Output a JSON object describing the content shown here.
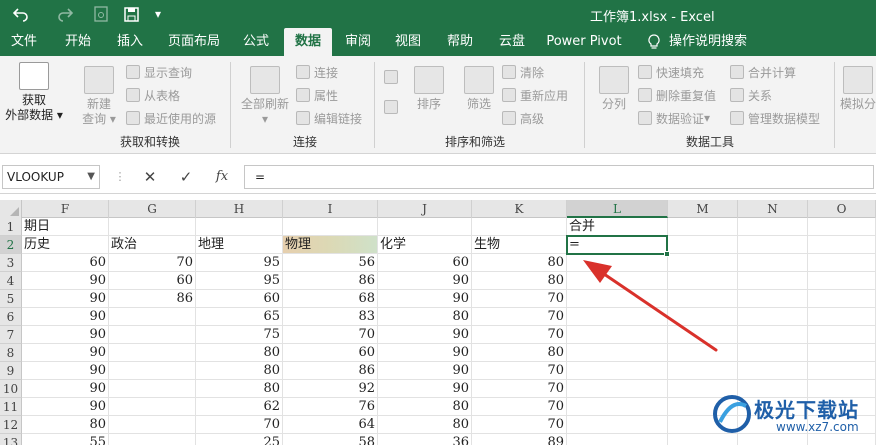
{
  "window": {
    "title": "工作簿1.xlsx  -  Excel"
  },
  "quick_access": {
    "undo_icon": "undo-icon",
    "redo_icon": "redo-icon",
    "save_icon": "save-icon"
  },
  "tabs": [
    "文件",
    "开始",
    "插入",
    "页面布局",
    "公式",
    "数据",
    "审阅",
    "视图",
    "帮助",
    "云盘",
    "Power Pivot",
    "操作说明搜索"
  ],
  "active_tab": "数据",
  "ribbon": {
    "get_data": {
      "label_line1": "获取",
      "label_line2": "外部数据"
    },
    "new_query": {
      "label_line1": "新建",
      "label_line2": "查询"
    },
    "show_query": "显示查询",
    "from_table": "从表格",
    "recent_sources": "最近使用的源",
    "group_get_transform": "获取和转换",
    "refresh_all": "全部刷新",
    "connections": "连接",
    "properties": "属性",
    "edit_links": "编辑链接",
    "group_connections": "连接",
    "sort": "排序",
    "filter": "筛选",
    "clear": "清除",
    "reapply": "重新应用",
    "advanced": "高级",
    "group_sort_filter": "排序和筛选",
    "split": "分列",
    "flash_fill": "快速填充",
    "remove_duplicates": "删除重复值",
    "data_validation": "数据验证",
    "consolidate": "合并计算",
    "relationships": "关系",
    "manage_model": "管理数据模型",
    "group_data_tools": "数据工具",
    "whatif": "模拟分"
  },
  "formula_bar": {
    "name_box": "VLOOKUP",
    "cancel": "✕",
    "enter": "✓",
    "fx": "fx",
    "content": "="
  },
  "columns": [
    "F",
    "G",
    "H",
    "I",
    "J",
    "K",
    "L",
    "M",
    "N",
    "O"
  ],
  "selected_column": "L",
  "rows": [
    "1",
    "2",
    "3",
    "4",
    "5",
    "6",
    "7",
    "8",
    "9",
    "10",
    "11",
    "12",
    "13"
  ],
  "selected_row": "2",
  "sheet": {
    "row1": {
      "F": "期日",
      "L": "合并"
    },
    "headers": [
      "历史",
      "政治",
      "地理",
      "物理",
      "化学",
      "生物"
    ],
    "active_input": "=",
    "data": [
      [
        "60",
        "70",
        "95",
        "56",
        "60",
        "80"
      ],
      [
        "90",
        "60",
        "95",
        "86",
        "90",
        "80"
      ],
      [
        "90",
        "86",
        "60",
        "68",
        "90",
        "70"
      ],
      [
        "90",
        "",
        "65",
        "83",
        "80",
        "70"
      ],
      [
        "90",
        "",
        "75",
        "70",
        "90",
        "70"
      ],
      [
        "90",
        "",
        "80",
        "60",
        "90",
        "80"
      ],
      [
        "90",
        "",
        "80",
        "86",
        "90",
        "70"
      ],
      [
        "90",
        "",
        "80",
        "92",
        "90",
        "70"
      ],
      [
        "90",
        "",
        "62",
        "76",
        "80",
        "70"
      ],
      [
        "80",
        "",
        "70",
        "64",
        "80",
        "70"
      ],
      [
        "55",
        "",
        "25",
        "58",
        "36",
        "89"
      ]
    ]
  },
  "colors": {
    "accent": "#217346",
    "arrow": "#d9312b",
    "watermark": "#1f5fa8"
  },
  "watermark": {
    "title": "极光下载站",
    "url": "www.xz7.com"
  }
}
